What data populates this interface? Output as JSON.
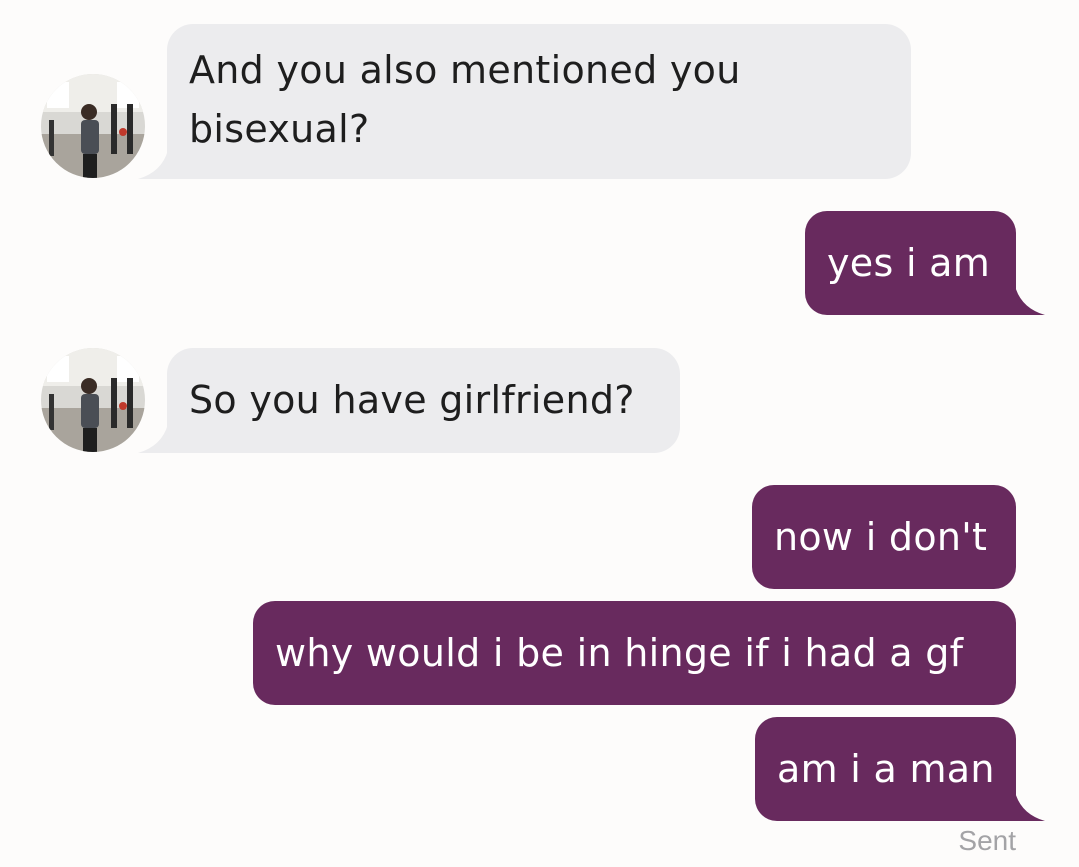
{
  "conversation": {
    "messages": [
      {
        "direction": "received",
        "lines": [
          "And you also mentioned you",
          "bisexual?"
        ]
      },
      {
        "direction": "sent",
        "text": "yes i am"
      },
      {
        "direction": "received",
        "text": "So you have girlfriend?"
      },
      {
        "direction": "sent",
        "text": "now i don't"
      },
      {
        "direction": "sent",
        "text": "why would i be in hinge if i had a gf"
      },
      {
        "direction": "sent",
        "text": "am i a man"
      }
    ],
    "status": "Sent"
  },
  "colors": {
    "background": "#fdfcfb",
    "incoming_bubble": "#ececee",
    "outgoing_bubble": "#682a5e",
    "status_text": "#a3a3a6"
  },
  "icons": {
    "avatar": "contact-photo-icon"
  }
}
